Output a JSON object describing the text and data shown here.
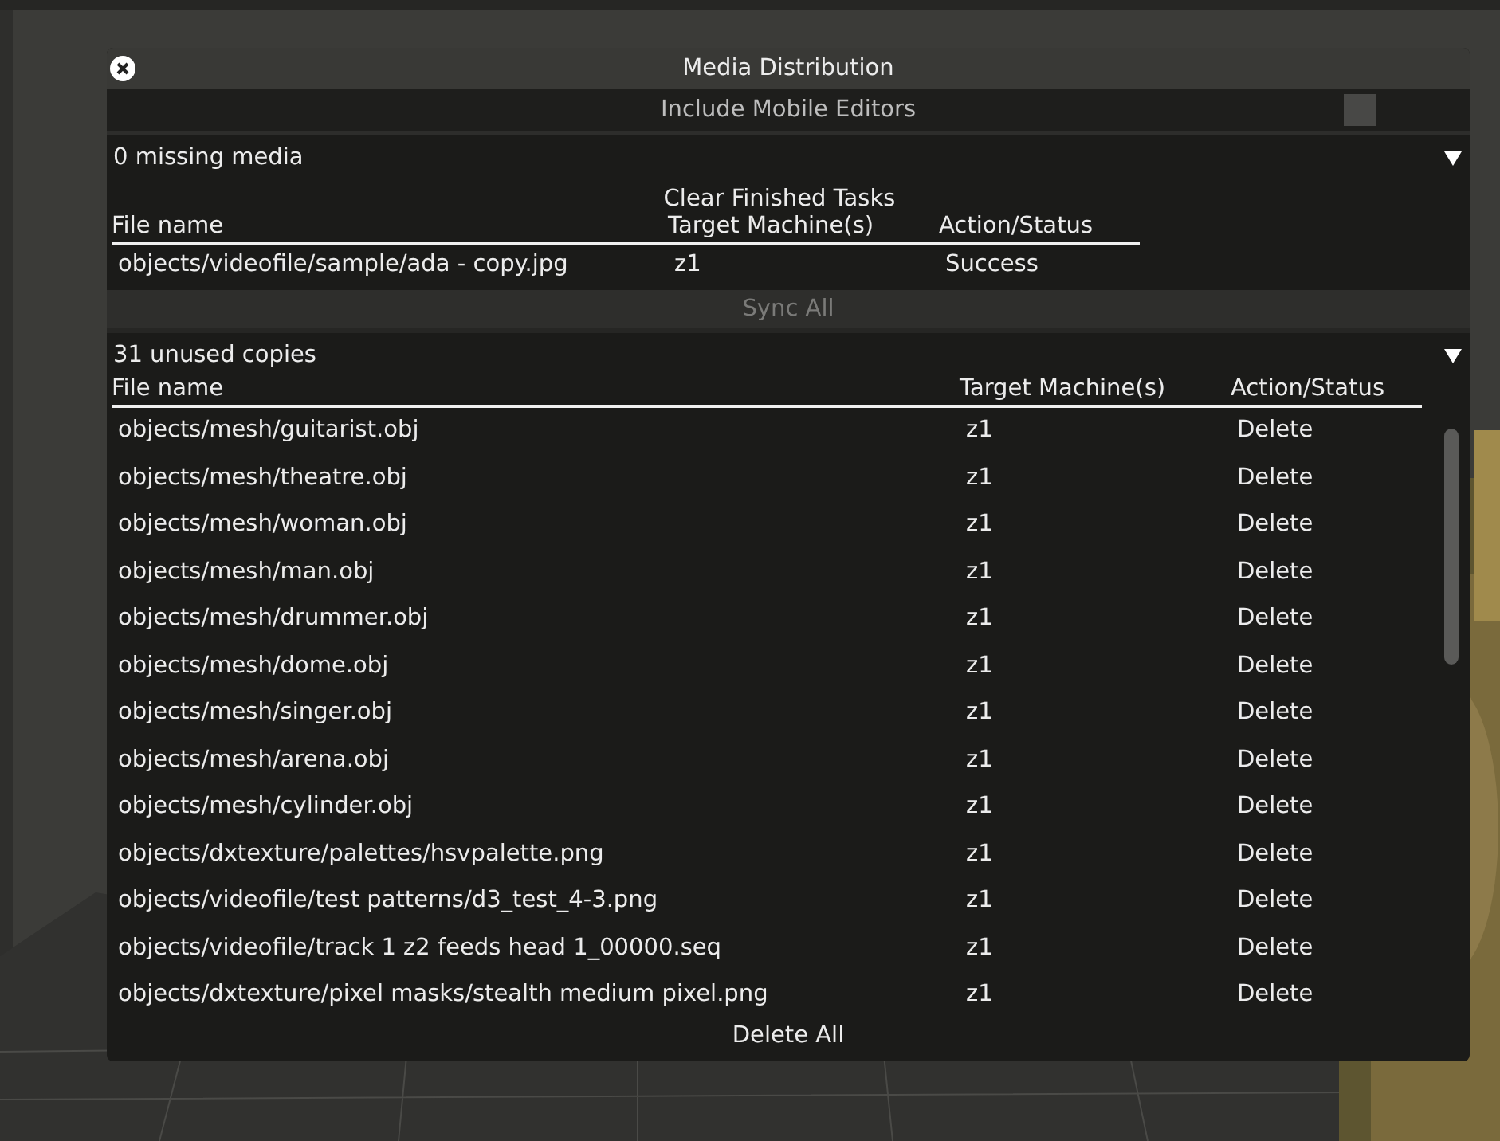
{
  "window": {
    "title": "Media Distribution"
  },
  "include_mobile_editors": {
    "label": "Include Mobile Editors",
    "checked": false
  },
  "missing_media": {
    "title": "0 missing media",
    "expanded": true,
    "clear_button": "Clear Finished Tasks",
    "columns": [
      "File name",
      "Target Machine(s)",
      "Action/Status"
    ],
    "rows": [
      {
        "file": "objects/videofile/sample/ada - copy.jpg",
        "target": "z1",
        "status": "Success"
      }
    ],
    "sync_button": {
      "label": "Sync All",
      "disabled": true
    }
  },
  "unused_copies": {
    "title": "31 unused copies",
    "expanded": true,
    "columns": [
      "File name",
      "Target Machine(s)",
      "Action/Status"
    ],
    "rows": [
      {
        "file": "objects/mesh/guitarist.obj",
        "target": "z1",
        "status": "Delete"
      },
      {
        "file": "objects/mesh/theatre.obj",
        "target": "z1",
        "status": "Delete"
      },
      {
        "file": "objects/mesh/woman.obj",
        "target": "z1",
        "status": "Delete"
      },
      {
        "file": "objects/mesh/man.obj",
        "target": "z1",
        "status": "Delete"
      },
      {
        "file": "objects/mesh/drummer.obj",
        "target": "z1",
        "status": "Delete"
      },
      {
        "file": "objects/mesh/dome.obj",
        "target": "z1",
        "status": "Delete"
      },
      {
        "file": "objects/mesh/singer.obj",
        "target": "z1",
        "status": "Delete"
      },
      {
        "file": "objects/mesh/arena.obj",
        "target": "z1",
        "status": "Delete"
      },
      {
        "file": "objects/mesh/cylinder.obj",
        "target": "z1",
        "status": "Delete"
      },
      {
        "file": "objects/dxtexture/palettes/hsvpalette.png",
        "target": "z1",
        "status": "Delete"
      },
      {
        "file": "objects/videofile/test patterns/d3_test_4-3.png",
        "target": "z1",
        "status": "Delete"
      },
      {
        "file": "objects/videofile/track 1 z2 feeds head 1_00000.seq",
        "target": "z1",
        "status": "Delete"
      },
      {
        "file": "objects/dxtexture/pixel masks/stealth medium pixel.png",
        "target": "z1",
        "status": "Delete"
      }
    ],
    "delete_button": "Delete All"
  }
}
